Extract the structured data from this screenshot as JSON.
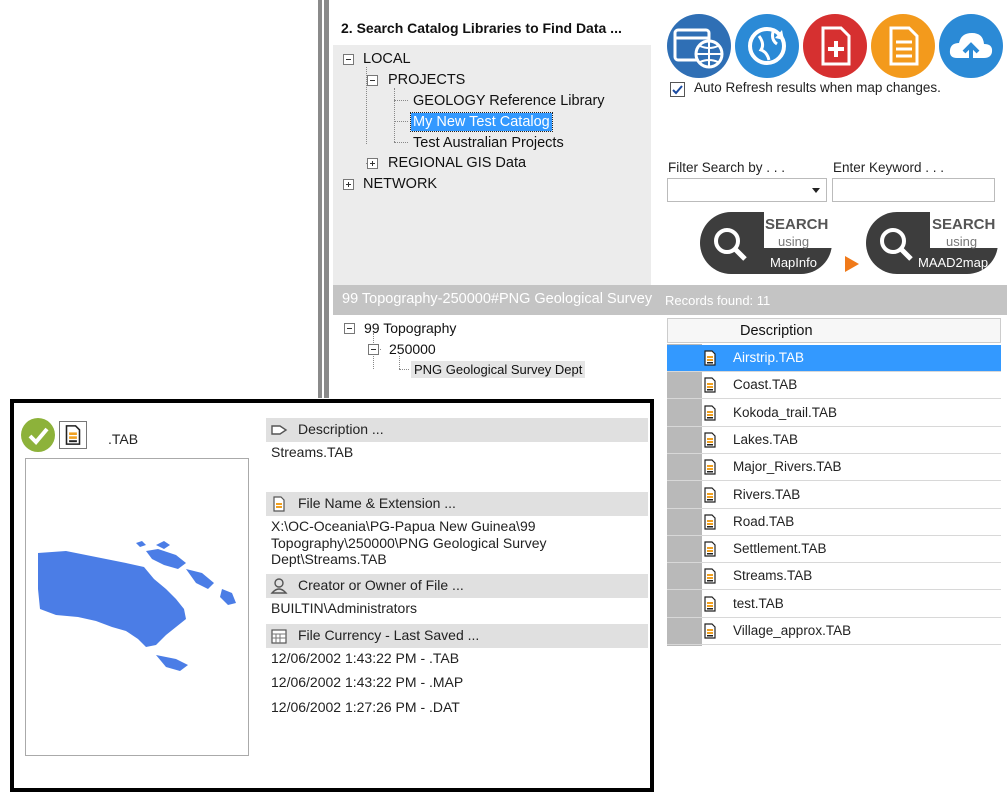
{
  "catalog": {
    "title": "2. Search Catalog Libraries to Find Data ...",
    "tree": {
      "local": "LOCAL",
      "projects": "PROJECTS",
      "geology": "GEOLOGY Reference Library",
      "my_new": "My New Test Catalog",
      "test_aus": "Test Australian Projects",
      "regional": "REGIONAL GIS Data",
      "network": "NETWORK"
    }
  },
  "toolbar": {
    "icons": [
      "browser-globe-icon",
      "refresh-globe-icon",
      "add-document-icon",
      "list-document-icon",
      "cloud-upload-icon"
    ],
    "colors": [
      "#2f6fb5",
      "#2b8ad6",
      "#d63030",
      "#f39a1c",
      "#2b8ad6"
    ]
  },
  "auto_refresh": {
    "label": "Auto Refresh results when map changes.",
    "checked": true
  },
  "filter": {
    "label": "Filter Search by . . .",
    "value": ""
  },
  "keyword": {
    "label": "Enter Keyword . . .",
    "value": ""
  },
  "search_mapinfo": {
    "line1": "SEARCH",
    "line2": "using",
    "line3": "MapInfo"
  },
  "search_maad": {
    "line1": "SEARCH",
    "line2": "using",
    "line3": "MAAD2map"
  },
  "results": {
    "path": "99 Topography-250000#PNG Geological Survey Dept",
    "count": "Records found: 11"
  },
  "path_tree": {
    "root": "99 Topography",
    "child": "250000",
    "leaf": "PNG Geological Survey Dept"
  },
  "table": {
    "header": "Description",
    "rows": [
      "Airstrip.TAB",
      "Coast.TAB",
      "Kokoda_trail.TAB",
      "Lakes.TAB",
      "Major_Rivers.TAB",
      "Rivers.TAB",
      "Road.TAB",
      "Settlement.TAB",
      "Streams.TAB",
      "test.TAB",
      "Village_approx.TAB"
    ],
    "selected_index": 0
  },
  "detail": {
    "ext": ".TAB",
    "description_header": "Description ...",
    "description": "Streams.TAB",
    "file_header": "File Name & Extension ...",
    "file_line1": "X:\\OC-Oceania\\PG-Papua New Guinea\\99",
    "file_line2": "Topography\\250000\\PNG Geological Survey",
    "file_line3": "Dept\\Streams.TAB",
    "creator_header": "Creator or Owner of File ...",
    "creator": "BUILTIN\\Administrators",
    "currency_header": "File Currency - Last Saved ...",
    "saved": [
      "12/06/2002 1:43:22 PM - .TAB",
      "12/06/2002 1:43:22 PM - .MAP",
      "12/06/2002 1:27:26 PM - .DAT"
    ]
  }
}
